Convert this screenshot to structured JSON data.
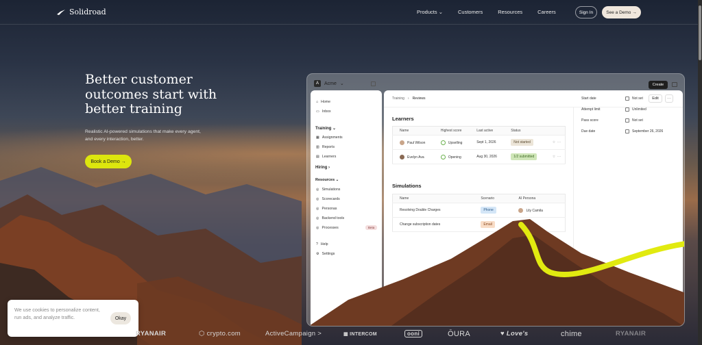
{
  "nav": {
    "brand": "Solidroad",
    "links": [
      "Products",
      "Customers",
      "Resources",
      "Careers"
    ],
    "sign_in": "Sign In",
    "see_demo": "See a Demo →"
  },
  "hero": {
    "title": "Better customer outcomes start with better training",
    "subtitle": "Realistic AI-powered simulations that make every agent, and every interaction, better.",
    "cta": "Book a Demo →"
  },
  "app": {
    "workspace": "Acme",
    "create": "Create",
    "sidebar": {
      "home": "Home",
      "inbox": "Inbox",
      "training_head": "Training",
      "assignments": "Assignments",
      "reports": "Reports",
      "learners": "Learners",
      "hiring_head": "Hiring",
      "resources_head": "Resources",
      "simulations": "Simulations",
      "scorecards": "Scorecards",
      "personas": "Personas",
      "backend_tools": "Backend tools",
      "processes": "Processes",
      "beta": "Beta",
      "help": "Help",
      "settings": "Settings"
    },
    "breadcrumb": [
      "Training",
      "Reviews"
    ],
    "edit": "Edit",
    "more": "···",
    "learners": {
      "title": "Learners",
      "headers": [
        "Name",
        "Highest score",
        "Last active",
        "Status"
      ],
      "rows": [
        {
          "name": "Paul Wilson",
          "score": "Upselling",
          "last": "Sept 1, 2026",
          "status": "Not started"
        },
        {
          "name": "Evelyn Ava",
          "score": "Opening",
          "last": "Aug 30, 2026",
          "status": "1/2 submitted"
        }
      ]
    },
    "simulations": {
      "title": "Simulations",
      "headers": [
        "Name",
        "Scenario",
        "AI Persona"
      ],
      "rows": [
        {
          "name": "Resolving Double Charges",
          "scenario": "Phone",
          "persona": "Lily Camila"
        },
        {
          "name": "Change subscription dates",
          "scenario": "Email",
          "persona": ""
        }
      ]
    },
    "properties": [
      {
        "label": "Start date",
        "value": "Not set"
      },
      {
        "label": "Attempt limit",
        "value": "Unlimited"
      },
      {
        "label": "Pass score",
        "value": "Not set"
      },
      {
        "label": "Due date",
        "value": "September 26, 2026"
      }
    ]
  },
  "cookie": {
    "text": "We use cookies to personalize content, run ads, and analyze traffic.",
    "ok": "Okay"
  },
  "logos": [
    "RYANAIR",
    "crypto.com",
    "ActiveCampaign >",
    "INTERCOM",
    "ooni",
    "ŌURA",
    "Love's",
    "chime",
    "RYANAIR"
  ],
  "colors": {
    "accent": "#dde60e",
    "demo_button": "#efe6dc"
  }
}
